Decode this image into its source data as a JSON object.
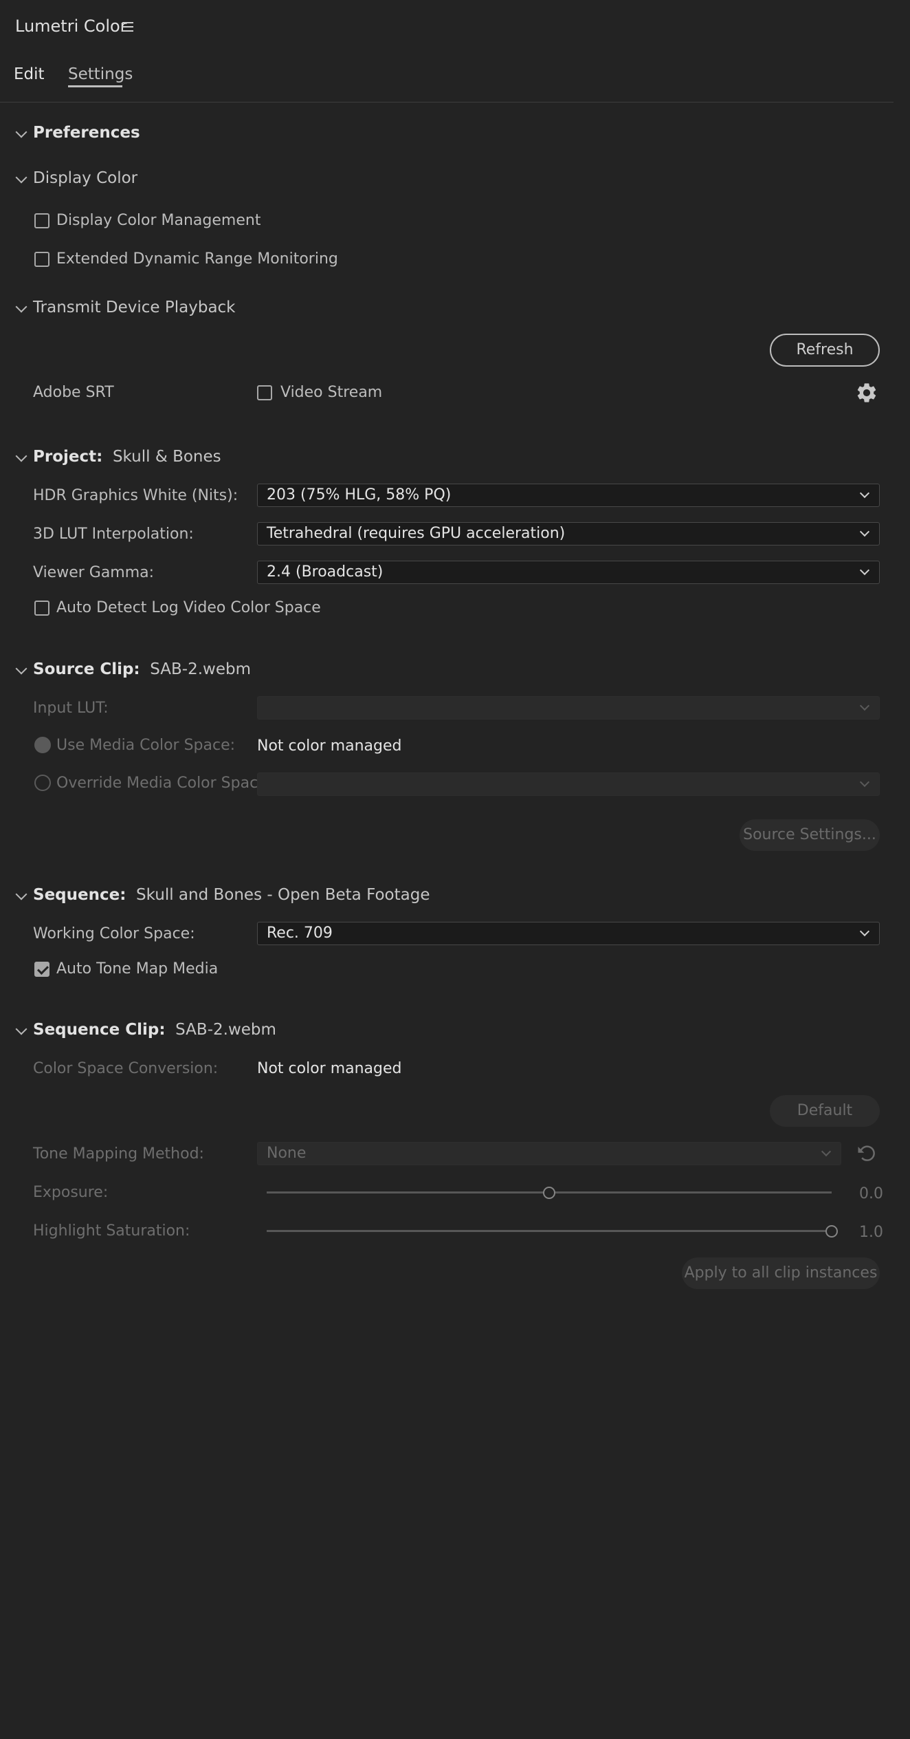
{
  "header": {
    "title": "Lumetri Color"
  },
  "tabs": [
    {
      "label": "Edit",
      "active": false
    },
    {
      "label": "Settings",
      "active": true
    }
  ],
  "preferences": {
    "heading": "Preferences"
  },
  "display_color": {
    "heading": "Display Color",
    "display_color_management": {
      "label": "Display Color Management",
      "checked": false
    },
    "edr_monitoring": {
      "label": "Extended Dynamic Range Monitoring",
      "checked": false
    }
  },
  "transmit": {
    "heading": "Transmit Device Playback",
    "refresh_label": "Refresh",
    "adobe_srt_label": "Adobe SRT",
    "video_stream": {
      "label": "Video Stream",
      "checked": false
    }
  },
  "project": {
    "heading": "Project:",
    "name": "Skull & Bones",
    "hdr_white_label": "HDR Graphics White (Nits):",
    "hdr_white_value": "203 (75% HLG, 58% PQ)",
    "lut_interp_label": "3D LUT Interpolation:",
    "lut_interp_value": "Tetrahedral (requires GPU acceleration)",
    "viewer_gamma_label": "Viewer Gamma:",
    "viewer_gamma_value": "2.4 (Broadcast)",
    "auto_detect_log": {
      "label": "Auto Detect Log Video Color Space",
      "checked": false
    }
  },
  "source_clip": {
    "heading": "Source Clip:",
    "name": "SAB-2.webm",
    "input_lut_label": "Input LUT:",
    "input_lut_value": "",
    "use_media_label": "Use Media Color Space:",
    "use_media_value": "Not color managed",
    "override_label": "Override Media Color Space:",
    "override_value": "",
    "source_settings_label": "Source Settings..."
  },
  "sequence": {
    "heading": "Sequence:",
    "name": "Skull and Bones - Open Beta Footage",
    "working_cs_label": "Working Color Space:",
    "working_cs_value": "Rec. 709",
    "auto_tone_map": {
      "label": "Auto Tone Map Media",
      "checked": true
    }
  },
  "sequence_clip": {
    "heading": "Sequence Clip:",
    "name": "SAB-2.webm",
    "csc_label": "Color Space Conversion:",
    "csc_value": "Not color managed",
    "default_label": "Default",
    "tone_mapping_label": "Tone Mapping Method:",
    "tone_mapping_value": "None",
    "exposure_label": "Exposure:",
    "exposure_value": "0.0",
    "exposure_level": 0.5,
    "highlight_sat_label": "Highlight Saturation:",
    "highlight_sat_value": "1.0",
    "highlight_sat_level": 1.0,
    "apply_all_label": "Apply to all clip instances"
  },
  "icons": {
    "menu": "hamburger-menu-icon",
    "gear": "gear-icon",
    "reset": "reset-icon",
    "chevron": "chevron-down-icon"
  },
  "colors": {
    "background": "#232323",
    "text": "#c8c8c8",
    "disabled_text": "#6e6e6e"
  }
}
